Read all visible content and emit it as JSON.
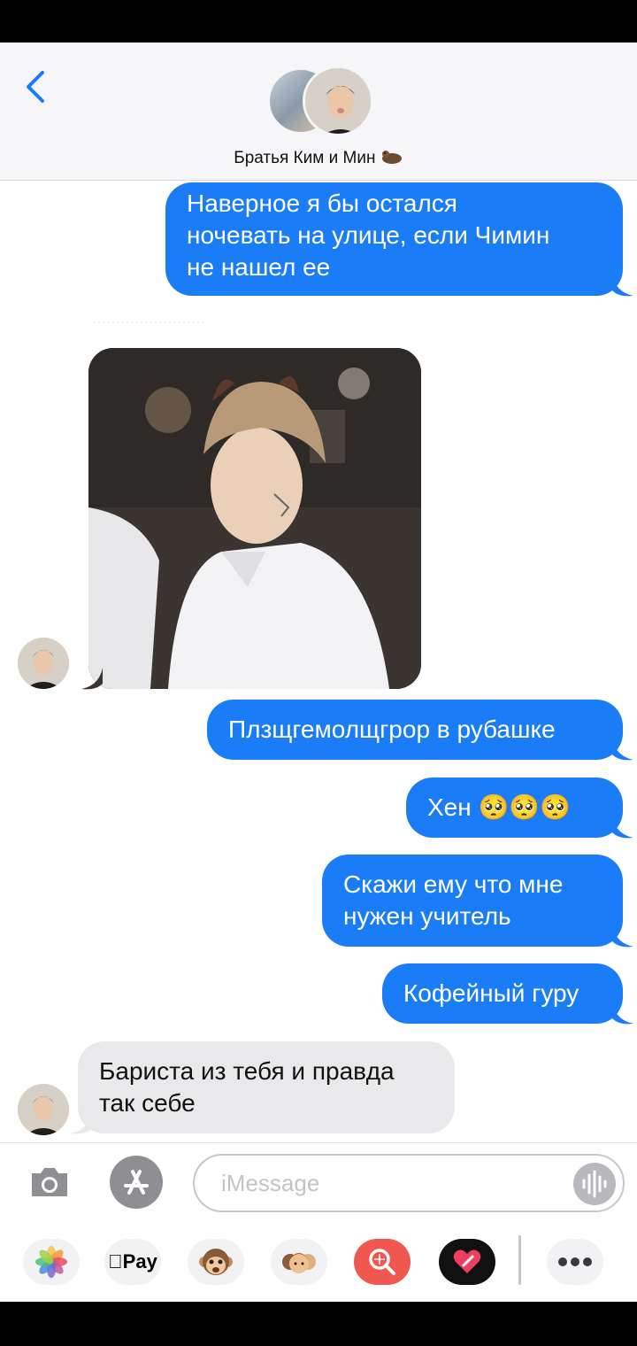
{
  "header": {
    "back_icon": "chevron-left-icon",
    "title": "Братья Ким и Мин",
    "title_emoji": "otter-emoji"
  },
  "messages": [
    {
      "direction": "outgoing",
      "text": "Наверное я бы остался\nночевать на улице, если Чимин\nне нашел ее"
    },
    {
      "direction": "incoming",
      "type": "photo",
      "description_icon": "photo-attachment"
    },
    {
      "direction": "outgoing",
      "text": "Плзщгемолщгрор в рубашке"
    },
    {
      "direction": "outgoing",
      "text": "Хен 🥺🥺🥺"
    },
    {
      "direction": "outgoing",
      "text": "Скажи ему что мне\nнужен учитель"
    },
    {
      "direction": "outgoing",
      "text": "Кофейный гуру"
    },
    {
      "direction": "incoming",
      "text": "Бариста из тебя и правда\nтак себе"
    }
  ],
  "input": {
    "placeholder": "iMessage",
    "camera_icon": "camera-icon",
    "appstore_icon": "app-store-icon",
    "voice_icon": "waveform-icon"
  },
  "apps": [
    {
      "name": "photos-icon"
    },
    {
      "name": "apple-pay-icon",
      "label": "Pay"
    },
    {
      "name": "animoji-icon"
    },
    {
      "name": "memoji-icon"
    },
    {
      "name": "image-search-icon"
    },
    {
      "name": "digital-touch-icon"
    },
    {
      "name": "more-icon"
    }
  ],
  "colors": {
    "outgoing_bubble": "#1a7cf7",
    "incoming_bubble": "#e9e9eb",
    "accent": "#1a7cf7"
  }
}
